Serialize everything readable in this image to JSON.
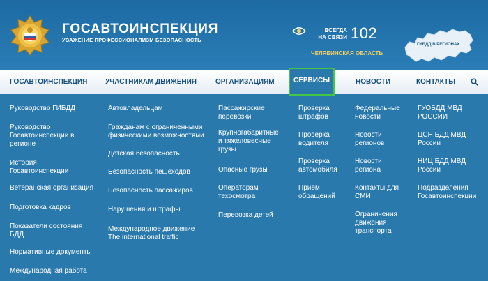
{
  "header": {
    "title": "ГОСАВТОИНСПЕКЦИЯ",
    "slogan": "УВАЖЕНИЕ ПРОФЕССИОНАЛИЗМ БЕЗОПАСНОСТЬ",
    "always_line1": "ВСЕГДА",
    "always_line2": "НА СВЯЗИ",
    "phone": "102",
    "region": "ЧЕЛЯБИНСКАЯ ОБЛАСТЬ",
    "map_label": "ГИБДД В РЕГИОНАХ"
  },
  "nav": {
    "items": [
      "ГОСАВТОИНСПЕКЦИЯ",
      "УЧАСТНИКАМ ДВИЖЕНИЯ",
      "ОРГАНИЗАЦИЯМ",
      "СЕРВИСЫ",
      "НОВОСТИ",
      "КОНТАКТЫ"
    ],
    "active": "СЕРВИСЫ"
  },
  "menu": {
    "col1": [
      [
        "Руководство ГИБДД"
      ],
      [
        "Руководство",
        "Госавтоинспекции в",
        "регионе"
      ],
      [
        "История",
        "Госавтоинспекции"
      ],
      [
        "Ветеранская организация"
      ],
      [
        "Подготовка кадров"
      ],
      [
        "Показатели состояния",
        "БДД"
      ],
      [
        "Нормативные документы"
      ],
      [
        "Международная работа"
      ]
    ],
    "col2": [
      [
        "Автовладельцам"
      ],
      [
        "Гражданам с ограниченными",
        "физическими возможностями"
      ],
      [
        "Детская безопасность"
      ],
      [
        "Безопасность пешеходов"
      ],
      [
        "Безопасность пассажиров"
      ],
      [
        "Нарушения и штрафы"
      ],
      [
        "Международное движение",
        "The international traffic"
      ]
    ],
    "col3": [
      [
        "Пассажирские",
        "перевозки"
      ],
      [
        "Крупногабаритные",
        "и тяжеловесные",
        "грузы"
      ],
      [
        "Опасные грузы"
      ],
      [
        "Операторам",
        "техосмотра"
      ],
      [
        "Перевозка детей"
      ]
    ],
    "col4": [
      [
        "Проверка",
        "штрафов"
      ],
      [
        "Проверка",
        "водителя"
      ],
      [
        "Проверка",
        "автомобиля"
      ],
      [
        "Прием",
        "обращений"
      ]
    ],
    "col5": [
      [
        "Федеральные",
        "новости"
      ],
      [
        "Новости",
        "регионов"
      ],
      [
        "Новости",
        "региона"
      ],
      [
        "Контакты для",
        "СМИ"
      ],
      [
        "Ограничения",
        "движения",
        "транспорта"
      ]
    ],
    "col6": [
      [
        "ГУОБДД МВД",
        "РОССИИ"
      ],
      [
        "ЦСН БДД МВД",
        "России"
      ],
      [
        "НИЦ БДД МВД",
        "России"
      ],
      [
        "Подразделения",
        "Госавтоинспекции"
      ]
    ]
  },
  "colors": {
    "background": "#2a79ad",
    "nav_text": "#15507f",
    "region_gold": "#f0d064",
    "active_border": "#43c646"
  }
}
